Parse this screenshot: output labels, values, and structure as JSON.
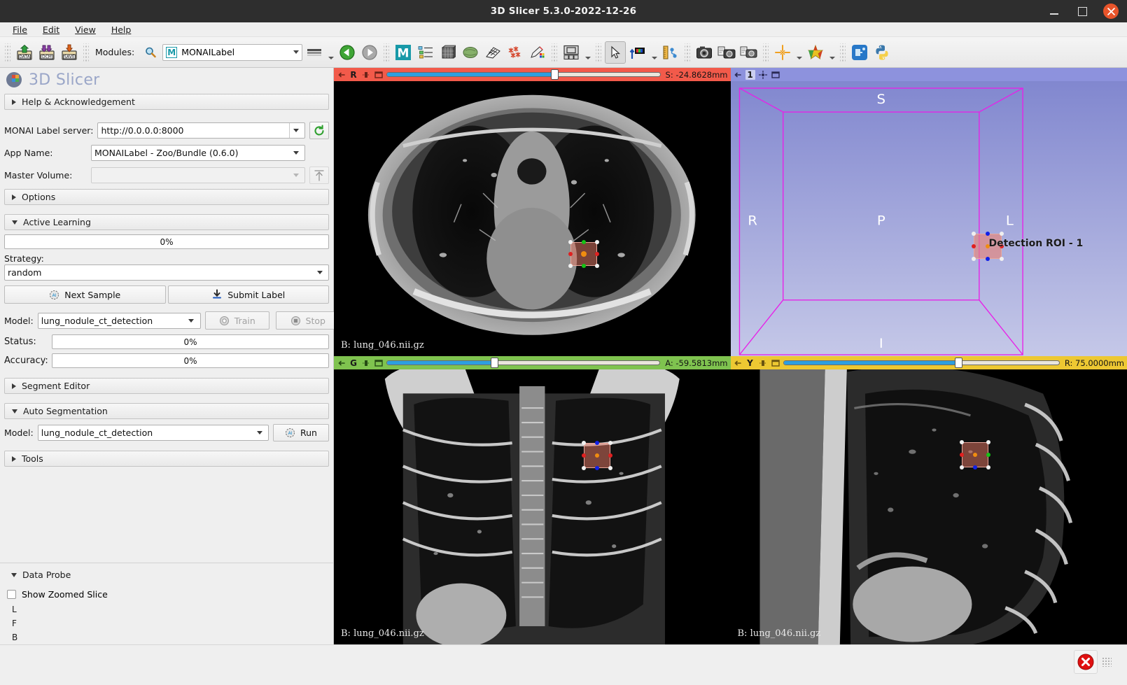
{
  "window": {
    "title": "3D Slicer 5.3.0-2022-12-26",
    "minimize_label": "Minimize",
    "maximize_label": "Maximize",
    "close_label": "Close"
  },
  "menu": {
    "items": [
      "File",
      "Edit",
      "View",
      "Help"
    ]
  },
  "toolbar": {
    "data_label": "DATA",
    "dcm_label": "DCM",
    "save_label": "SAVE",
    "modules_label": "Modules:",
    "search_icon": "search-icon",
    "module_value": "MONAILabel",
    "module_badge": "M",
    "icons": [
      "layout-icon",
      "previous-module-icon",
      "next-module-icon",
      "monailabel-module-icon",
      "subject-hierarchy-icon",
      "volume-rendering-icon",
      "segmentations-icon",
      "grid-transform-icon",
      "markups-icon",
      "annotations-icon",
      "layout-four-up-icon",
      "mouse-pointer-icon",
      "window-level-icon",
      "crosshair-ruler-icon",
      "screenshot-icon",
      "scene-views-capture-icon",
      "scene-views-restore-icon",
      "crosshair-icon",
      "markups-color-icon",
      "extension-manager-icon",
      "python-console-icon"
    ]
  },
  "left_panel": {
    "brand": "3D Slicer",
    "brand_logo": "slicer-logo-icon",
    "help_section": "Help & Acknowledgement",
    "server_label": "MONAI Label server:",
    "server_value": "http://0.0.0.0:8000",
    "refresh_icon": "refresh-icon",
    "app_name_label": "App Name:",
    "app_name_value": "MONAILabel - Zoo/Bundle (0.6.0)",
    "master_volume_label": "Master Volume:",
    "master_volume_value": "",
    "upload_icon": "upload-volume-icon",
    "options_section": "Options",
    "active_learning_section": "Active Learning",
    "active_learning_progress": "0%",
    "strategy_label": "Strategy:",
    "strategy_value": "random",
    "next_sample_label": "Next Sample",
    "submit_label_label": "Submit Label",
    "model_label": "Model:",
    "model_value": "lung_nodule_ct_detection",
    "train_label": "Train",
    "stop_label": "Stop",
    "status_label": "Status:",
    "status_value": "0%",
    "accuracy_label": "Accuracy:",
    "accuracy_value": "0%",
    "segment_editor_section": "Segment Editor",
    "auto_segmentation_section": "Auto Segmentation",
    "auto_model_label": "Model:",
    "auto_model_value": "lung_nodule_ct_detection",
    "run_label": "Run",
    "tools_section": "Tools",
    "data_probe_section": "Data Probe",
    "show_zoomed_slice_label": "Show Zoomed Slice",
    "probe_lines": [
      "L",
      "F",
      "B"
    ]
  },
  "views": {
    "axial": {
      "letter": "R",
      "color": "#f25a4a",
      "slice_value": "S: -24.8628mm",
      "slider_percent": 62,
      "volume_label": "B: lung_046.nii.gz",
      "pin_icon": "pin-icon",
      "visibility_icon": "slice-visibility-icon",
      "maximize_icon": "maximize-view-icon"
    },
    "threed": {
      "letter": "1",
      "color": "#8d92dd",
      "pin_icon": "pin-icon",
      "center_icon": "center-view-icon",
      "maximize_icon": "maximize-view-icon",
      "orientations": {
        "superior": "S",
        "inferior": "I",
        "right": "R",
        "left": "L",
        "posterior": "P"
      },
      "roi_label": "Detection ROI - 1",
      "box_color": "#e81fe8"
    },
    "coronal": {
      "letter": "G",
      "color": "#7fc34f",
      "slice_value": "A: -59.5813mm",
      "slider_percent": 41,
      "volume_label": "B: lung_046.nii.gz",
      "pin_icon": "pin-icon",
      "visibility_icon": "slice-visibility-icon",
      "maximize_icon": "maximize-view-icon"
    },
    "sagittal": {
      "letter": "Y",
      "color": "#edc832",
      "slice_value": "R: 75.0000mm",
      "slider_percent": 64,
      "volume_label": "B: lung_046.nii.gz",
      "pin_icon": "pin-icon",
      "visibility_icon": "slice-visibility-icon",
      "maximize_icon": "maximize-view-icon"
    }
  },
  "status_bar": {
    "error_icon": "error-log-icon",
    "resize_grip": "resize-grip-icon"
  }
}
